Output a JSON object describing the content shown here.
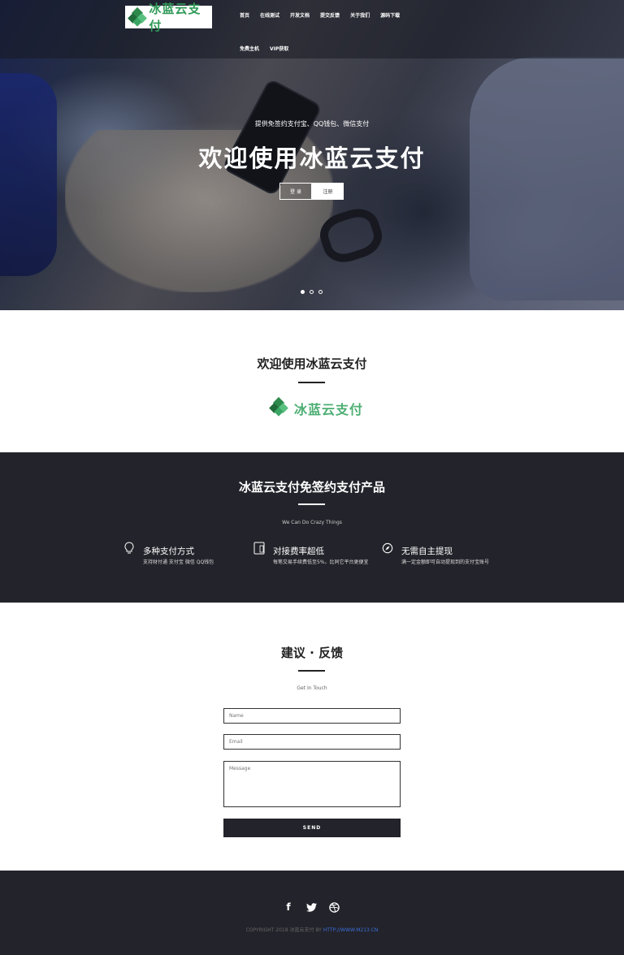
{
  "nav": {
    "logo_text": "冰蓝云支付",
    "items_row1": [
      "首页",
      "在线测试",
      "开发文档",
      "提交反馈",
      "关于我们",
      "源码下载"
    ],
    "items_row2": [
      "免费主机",
      "VIP获取"
    ]
  },
  "hero": {
    "subtitle": "提供免签约支付宝、QQ钱包、微信支付",
    "title_prefix": "欢迎使用",
    "title_bold": "冰蓝云支付",
    "login_label": "登 录",
    "register_label": "注册",
    "slides": 3,
    "active_slide": 1
  },
  "welcome": {
    "title_prefix": "欢迎使用",
    "title_bold": "冰蓝云支付",
    "logo_text": "冰蓝云支付"
  },
  "products": {
    "title": "冰蓝云支付免签约支付产品",
    "subtitle": "We Can Do Crazy Things",
    "features": [
      {
        "icon": "lightbulb-icon",
        "title": "多种支付方式",
        "desc": "支持财付通 支付宝 微信 QQ钱包"
      },
      {
        "icon": "mobile-icon",
        "title": "对接费率超低",
        "desc": "每笔交易手续费低至5%，比同它平台更便宜"
      },
      {
        "icon": "compass-icon",
        "title": "无需自主提现",
        "desc": "满一定金额即可自动提现到的支付宝账号"
      }
    ]
  },
  "feedback": {
    "title": "建议 · 反馈",
    "subtitle": "Get In Touch",
    "name_placeholder": "Name",
    "email_placeholder": "Email",
    "message_placeholder": "Message",
    "send_label": "SEND"
  },
  "footer": {
    "social": [
      "facebook-icon",
      "twitter-icon",
      "dribbble-icon"
    ],
    "copyright": "COPYRIGHT 2018 冰蓝云支付 BY",
    "link": "HTTP://WWW.M213.CN"
  }
}
